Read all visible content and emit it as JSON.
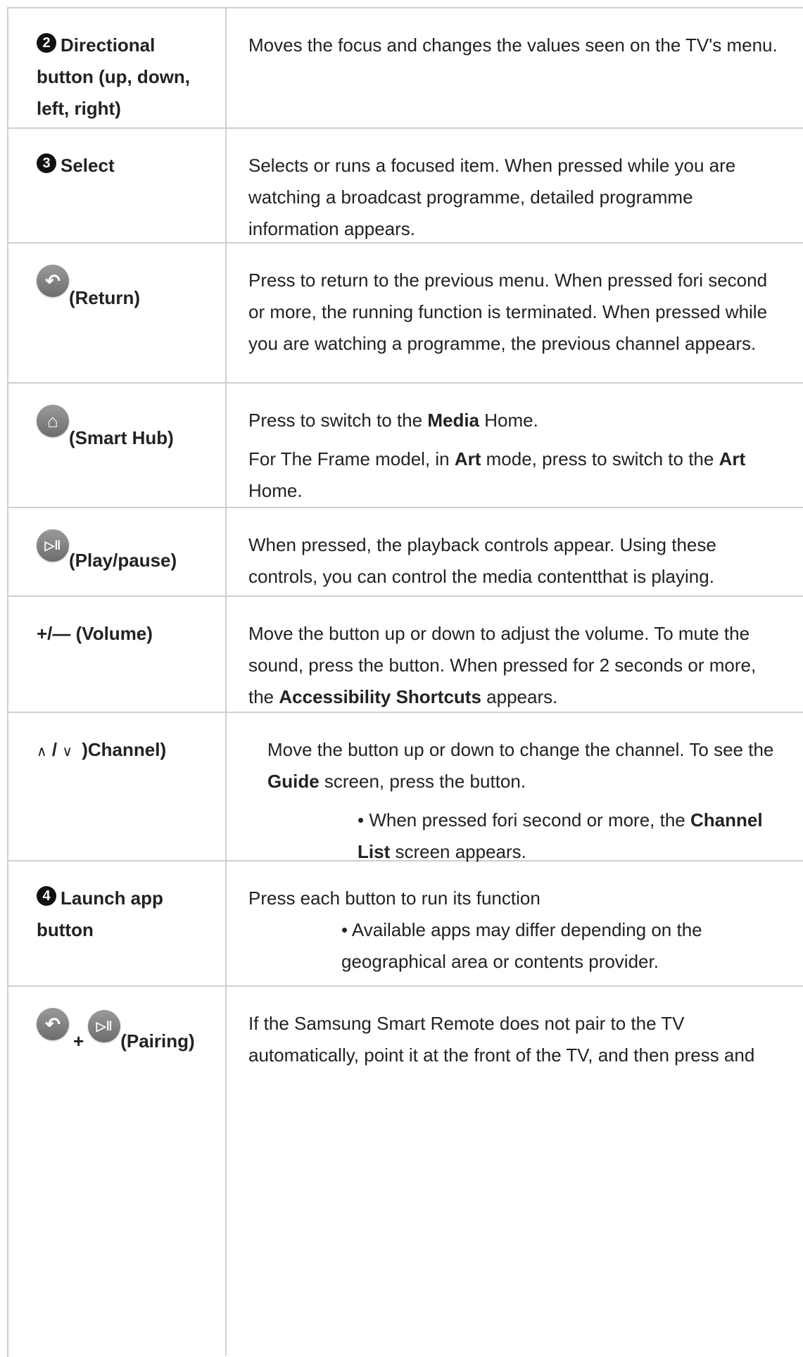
{
  "rows": [
    {
      "badge": "2",
      "label": "Directional button (up, down, left, right)",
      "desc": "Moves the focus and changes the values seen on the TV's menu."
    },
    {
      "badge": "3",
      "label": "Select",
      "desc": "Selects or runs a focused item. When pressed while you are watching a broadcast programme, detailed programme information appears."
    },
    {
      "icon": "return-icon",
      "label": "(Return)",
      "desc": "Press to return to the previous menu. When pressed fori second or more, the running function is terminated. When pressed while you are watching a programme, the previous channel appears."
    },
    {
      "icon": "home-icon",
      "label": "(Smart Hub)",
      "desc_a1": "Press to switch to the ",
      "desc_a_bold": "Media",
      "desc_a2": " Home.",
      "desc_b1": "For The Frame model, in ",
      "desc_b_bold1": "Art",
      "desc_b2": " mode, press to switch to the ",
      "desc_b_bold2": "Art",
      "desc_b3": " Home."
    },
    {
      "icon": "play-pause-icon",
      "label": "(Play/pause)",
      "desc": "When pressed, the playback controls appear. Using these controls, you can control the media contentthat is playing."
    },
    {
      "label": "+/— (Volume)",
      "desc1": "Move the button up or down to adjust the volume. To mute the sound, press the button. When pressed for 2 seconds or more, the ",
      "desc_bold": "Accessibility Shortcuts",
      "desc2": " appears."
    },
    {
      "label_up": "∧",
      "label_slash": "/",
      "label_down": "∨",
      "label": ")Channel)",
      "desc1": "Move the button up or down to change the channel. To see the ",
      "desc_bold": "Guide",
      "desc2": " screen, press the button.",
      "bullet1": "• When pressed fori second or more, the ",
      "bullet_bold": "Channel List",
      "bullet2": " screen appears."
    },
    {
      "badge": "4",
      "label": "Launch app button",
      "desc": "Press each button to run its function",
      "bullet": "• Available apps may differ depending on the geographical area or contents provider."
    },
    {
      "icon1": "return-icon",
      "plus": "+",
      "icon2": "play-pause-icon",
      "label": "(Pairing)",
      "desc": "If the Samsung Smart Remote does not pair to the TV automatically, point it at the front of the TV, and then press and"
    }
  ]
}
